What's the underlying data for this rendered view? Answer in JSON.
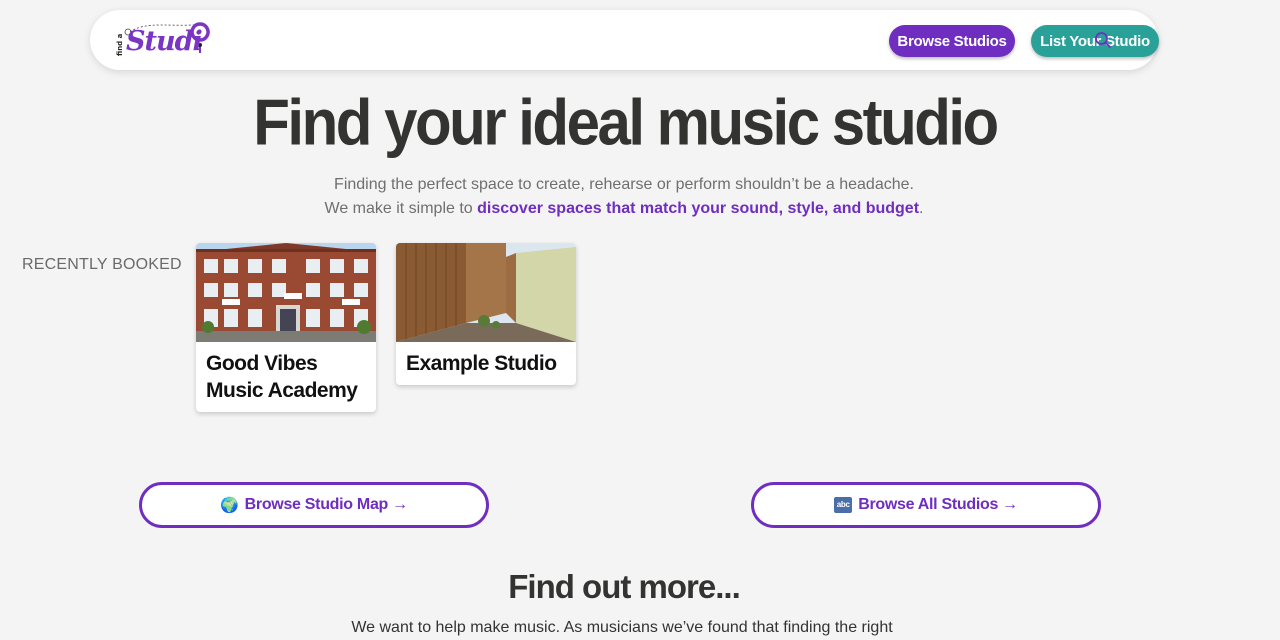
{
  "header": {
    "logo_small": "find a",
    "logo_big": "Studi",
    "browse_label": "Browse Studios",
    "list_label": "List Your Studio",
    "search_icon": "search-icon"
  },
  "hero": {
    "title": "Find your ideal music studio",
    "sub1": "Finding the perfect space to create, rehearse or perform shouldn’t be a headache.",
    "sub2_prefix": "We make it simple to ",
    "sub2_link": "discover spaces that match your sound, style, and budget",
    "sub2_suffix": "."
  },
  "recent": {
    "label": "RECENTLY BOOKED",
    "cards": [
      {
        "title": "Good Vibes Music Academy"
      },
      {
        "title": "Example Studio"
      }
    ]
  },
  "actions": {
    "map_emoji": "🌍",
    "map_label": "Browse Studio Map",
    "all_emoji": "abc",
    "all_label": "Browse All Studios",
    "arrow": "→"
  },
  "more": {
    "title": "Find out more...",
    "text": "We want to help make music. As musicians we’ve found that finding the right"
  },
  "colors": {
    "brand_purple": "#6f2ec0",
    "brand_teal": "#2aa198",
    "background": "#f4f4f4"
  }
}
